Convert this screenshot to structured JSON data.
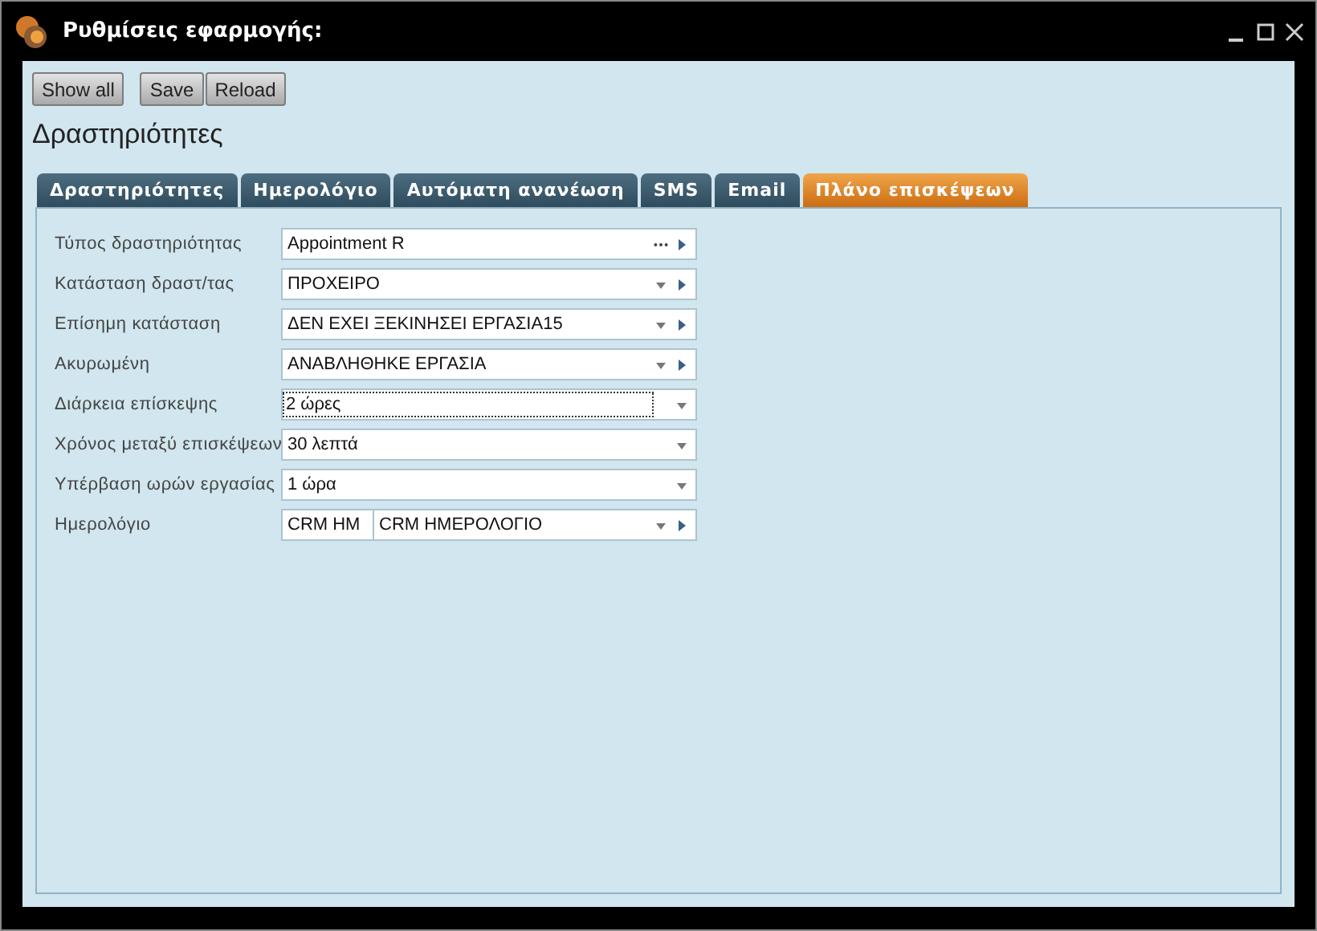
{
  "window": {
    "title": "Ρυθμίσεις εφαρμογής:"
  },
  "toolbar": {
    "buttons": [
      "Show all",
      "Save",
      "Reload"
    ]
  },
  "heading": "Δραστηριότητες",
  "tabs": [
    {
      "label": "Δραστηριότητες",
      "selected": false
    },
    {
      "label": "Ημερολόγιο",
      "selected": false
    },
    {
      "label": "Αυτόματη ανανέωση",
      "selected": false
    },
    {
      "label": "SMS",
      "selected": false
    },
    {
      "label": "Email",
      "selected": false
    },
    {
      "label": "Πλάνο επισκέψεων",
      "selected": true
    }
  ],
  "fields": [
    {
      "label": "Τύπος δραστηριότητας",
      "kind": "lookup",
      "value": "Appointment R",
      "focused": false
    },
    {
      "label": "Κατάσταση δραστ/τας",
      "kind": "combo-link",
      "value": "ΠΡΟΧΕΙΡΟ",
      "focused": false
    },
    {
      "label": "Επίσημη κατάσταση",
      "kind": "combo-link",
      "value": "ΔΕΝ ΕΧΕΙ ΞΕΚΙΝΗΣΕΙ ΕΡΓΑΣΙΑ15",
      "focused": false
    },
    {
      "label": "Ακυρωμένη",
      "kind": "combo-link",
      "value": "ΑΝΑΒΛΗΘΗΚΕ ΕΡΓΑΣΙΑ",
      "focused": false
    },
    {
      "label": "Διάρκεια επίσκεψης",
      "kind": "combo",
      "value": "2 ώρες",
      "focused": true
    },
    {
      "label": "Χρόνος μεταξύ επισκέψεων",
      "kind": "combo",
      "value": "30 λεπτά",
      "focused": false
    },
    {
      "label": "Υπέρβαση ωρών εργασίας",
      "kind": "combo",
      "value": "1 ώρα",
      "focused": false
    },
    {
      "label": "Ημερολόγιο",
      "kind": "code-lookup",
      "code": "CRM HM",
      "value": "CRM ΗΜΕΡΟΛΟΓΙΟ",
      "focused": false
    }
  ]
}
